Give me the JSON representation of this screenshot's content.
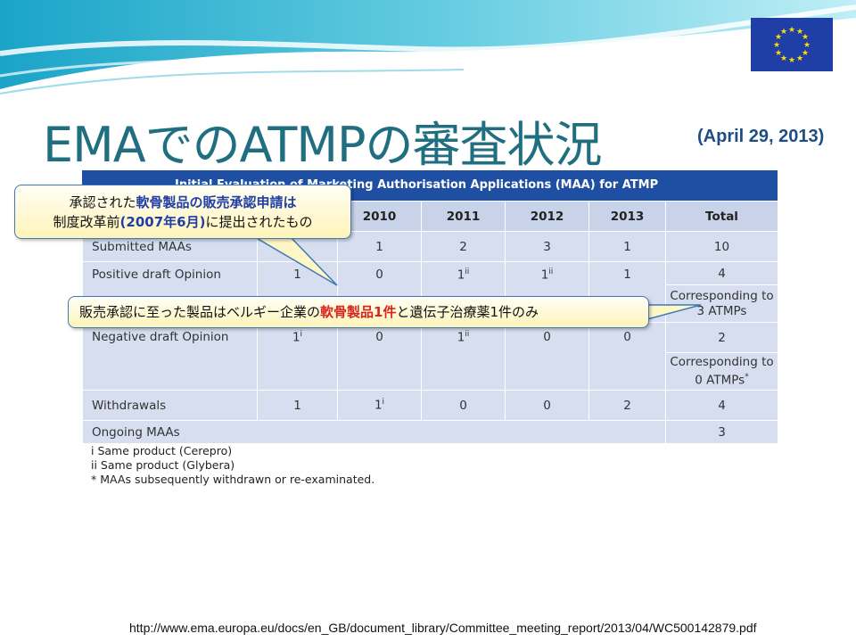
{
  "slide": {
    "title": "EMAでのATMPの審査状況",
    "date": "(April 29, 2013)",
    "source_url": "http://www.ema.europa.eu/docs/en_GB/document_library/Committee_meeting_report/2013/04/WC500142879.pdf"
  },
  "table": {
    "title": "Initial Evaluation of Marketing Authorisation Applications (MAA) for ATMP",
    "years": [
      "2010",
      "2011",
      "2012",
      "2013",
      "Total"
    ],
    "rows": {
      "submitted": {
        "label": "Submitted MAAs",
        "values": [
          "1",
          "2",
          "3",
          "1",
          "10"
        ]
      },
      "positive": {
        "label": "Positive draft Opinion",
        "first": "1",
        "values": [
          "0",
          "1",
          "1",
          "1",
          "4"
        ],
        "corresponding": "Corresponding to 3 ATMPs"
      },
      "negative": {
        "label": "Negative draft Opinion",
        "first": "1",
        "values": [
          "0",
          "1",
          "0",
          "0",
          "2"
        ],
        "corresponding": "Corresponding to 0 ATMPs"
      },
      "withdrawals": {
        "label": "Withdrawals",
        "first": "1",
        "values": [
          "1",
          "0",
          "0",
          "2",
          "4"
        ]
      },
      "ongoing": {
        "label": "Ongoing MAAs",
        "total": "3"
      }
    },
    "marks": {
      "i": "i",
      "ii": "ii",
      "star": "*"
    },
    "notes": [
      "i Same product (Cerepro)",
      "ii Same product (Glybera)",
      "* MAAs subsequently withdrawn or re-examinated."
    ]
  },
  "callout1": {
    "line1_a": "承認された",
    "line1_b": "軟骨製品の販売承認申請は",
    "line2_a": "制度改革前",
    "line2_b": "(2007年6月)",
    "line2_c": "に提出されたもの"
  },
  "callout2": {
    "a": "販売承認に至った製品はベルギー企業の",
    "b": "軟骨製品1件",
    "c": "と遺伝子治療薬1件のみ"
  },
  "colors": {
    "title": "#1f6f80",
    "table_header": "#1f4fa3",
    "cell": "#d6def0",
    "flag": "#1f3ea6",
    "star": "#ffdd00",
    "highlight_blue": "#1f3ea6",
    "highlight_red": "#d8261c"
  },
  "icons": {
    "flag": "eu-flag-icon"
  }
}
